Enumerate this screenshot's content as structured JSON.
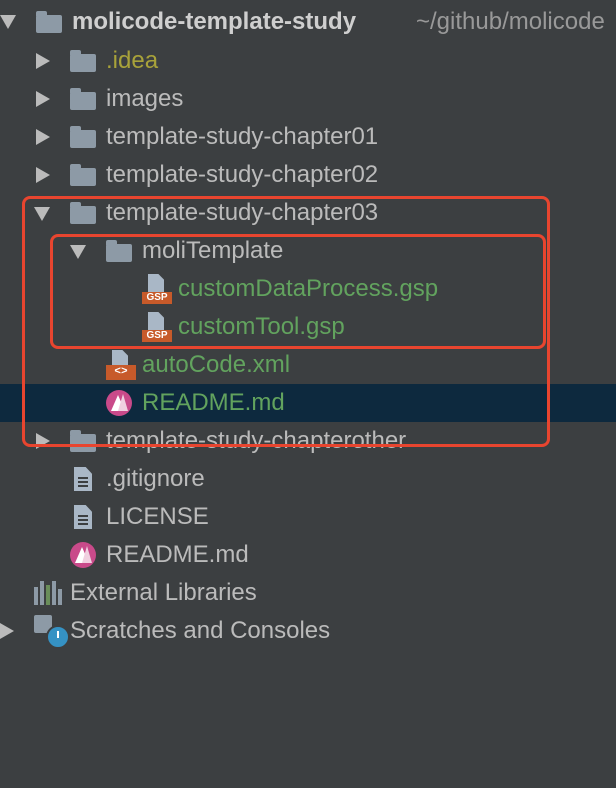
{
  "project": {
    "name": "molicode-template-study",
    "path": "~/github/molicode"
  },
  "items": {
    "idea": ".idea",
    "images": "images",
    "chapter01": "template-study-chapter01",
    "chapter02": "template-study-chapter02",
    "chapter03": "template-study-chapter03",
    "moliTemplate": "moliTemplate",
    "customDataProcess": "customDataProcess.gsp",
    "customTool": "customTool.gsp",
    "autoCode": "autoCode.xml",
    "readmeChapter": "README.md",
    "chapterother": "template-study-chapterother",
    "gitignore": ".gitignore",
    "license": "LICENSE",
    "readmeRoot": "README.md",
    "externalLibraries": "External Libraries",
    "scratches": "Scratches and Consoles"
  },
  "badges": {
    "gsp": "GSP",
    "xml": "<>"
  },
  "colors": {
    "background": "#3c3f41",
    "selection": "#0d293e",
    "text": "#bbbbbb",
    "added_file_green": "#62a35e",
    "excluded_olive": "#a8a23a",
    "highlight_red": "#e8452f"
  },
  "icons": {
    "project": "module-folder-icon",
    "folder": "folder-icon",
    "gsp": "gsp-file-icon",
    "xml": "xml-file-icon",
    "markdown": "markdown-file-icon",
    "text": "text-file-icon",
    "libraries": "external-libraries-icon",
    "scratches": "scratches-icon"
  }
}
